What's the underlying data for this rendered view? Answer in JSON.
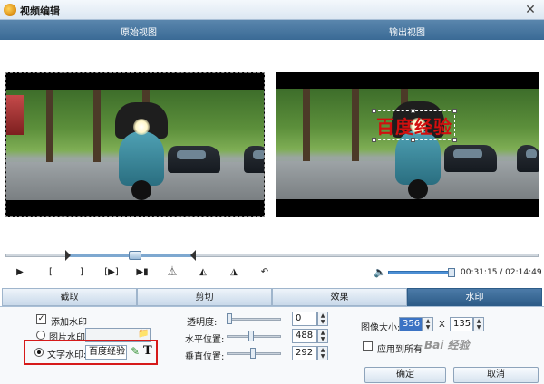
{
  "window": {
    "title": "视频编辑",
    "close_glyph": "✕"
  },
  "views": {
    "original_label": "原始视图",
    "output_label": "输出视图"
  },
  "watermark_overlay_text": "百度经验",
  "controls": {
    "play": "▶",
    "mark_in": "[",
    "mark_out": "]",
    "play_selection": "[▶]",
    "prev_frame": "▶▮",
    "flip_v": "⏅",
    "rotate_left": "◭",
    "rotate_right": "◮",
    "undo": "↶",
    "volume_icon": "🔈",
    "time": "00:31:15 / 02:14:49",
    "volume_level": 0.9,
    "timeline_position": 0.24
  },
  "tabs": [
    {
      "label": "截取"
    },
    {
      "label": "剪切"
    },
    {
      "label": "效果"
    },
    {
      "label": "水印",
      "active": true
    }
  ],
  "watermark_panel": {
    "add_watermark_label": "添加水印",
    "image_watermark_label": "图片水印:",
    "text_watermark_label": "文字水印:",
    "text_value": "百度经验",
    "transparency_label": "透明度:",
    "transparency_value": "0",
    "hpos_label": "水平位置:",
    "hpos_value": "488",
    "vpos_label": "垂直位置:",
    "vpos_value": "292",
    "image_size_label": "图像大小:",
    "width_value": "356",
    "times": "X",
    "height_value": "135",
    "apply_all_label": "应用到所有",
    "confirm_label": "确定",
    "cancel_label": "取消",
    "pen_icon": "✎",
    "text_icon": "T",
    "folder_icon": "📁"
  },
  "source_watermark": "Bai  经验"
}
